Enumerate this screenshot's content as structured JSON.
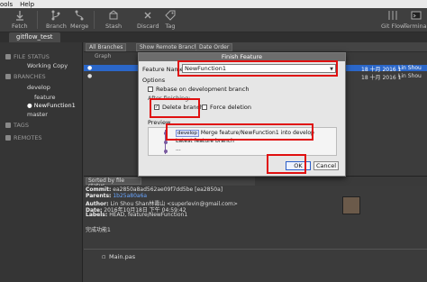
{
  "menubar": {
    "items": [
      "ools",
      "Help"
    ]
  },
  "toolbar": {
    "buttons": [
      {
        "label": "Fetch"
      },
      {
        "label": "Branch"
      },
      {
        "label": "Merge"
      },
      {
        "label": "Stash"
      },
      {
        "label": "Discard"
      },
      {
        "label": "Tag"
      },
      {
        "label": "Git Flow"
      },
      {
        "label": "Terminal"
      }
    ]
  },
  "tab": {
    "label": "gitflow_test"
  },
  "sidebar": {
    "file_status": "FILE STATUS",
    "working_copy": "Working Copy",
    "branches": "BRANCHES",
    "develop": "develop",
    "feature": "feature",
    "newfunction": "NewFunction1",
    "master": "master",
    "tags": "TAGS",
    "remotes": "REMOTES"
  },
  "filterbar": {
    "all_branches": "All Branches",
    "show_remote": "Show Remote Branches",
    "date_order": "Date Order"
  },
  "colhead": {
    "graph": "Graph"
  },
  "rows": [
    {
      "date": "18 十月 2016 1",
      "author": "Lin Shou"
    },
    {
      "date": "18 十月 2016 1",
      "author": "Lin Shou"
    }
  ],
  "dialog": {
    "title": "Finish Feature",
    "feature_name_label": "Feature Name:",
    "feature_name_value": "NewFunction1",
    "options_label": "Options",
    "rebase_label": "Rebase on development branch",
    "after_finishing": "After finishing:",
    "delete_branch": "Delete branch",
    "force_deletion": "Force deletion",
    "preview_label": "Preview",
    "preview_tag": "develop",
    "preview_msg": "Merge feature/NewFunction1 into develop",
    "preview_latest": "Latest feature branch",
    "preview_dots": "...",
    "ok": "OK",
    "cancel": "Cancel"
  },
  "bottom": {
    "sort_label": "Sorted by file status",
    "commit_label": "Commit:",
    "commit_value": "ea2850a8ad562ae09f7dd5be [ea2850a]",
    "parents_label": "Parents:",
    "parents_value": "1b25a80a6a",
    "author_label": "Author:",
    "author_value": "Lin Shou Shan林壽山 <superlevin@gmail.com>",
    "date_label": "Date:",
    "date_value": "2016年10月18日 下午 04:59:42",
    "labels_label": "Labels:",
    "labels_value": "HEAD, feature/NewFunction1",
    "message": "完成功能1",
    "file": "Main.pas"
  }
}
